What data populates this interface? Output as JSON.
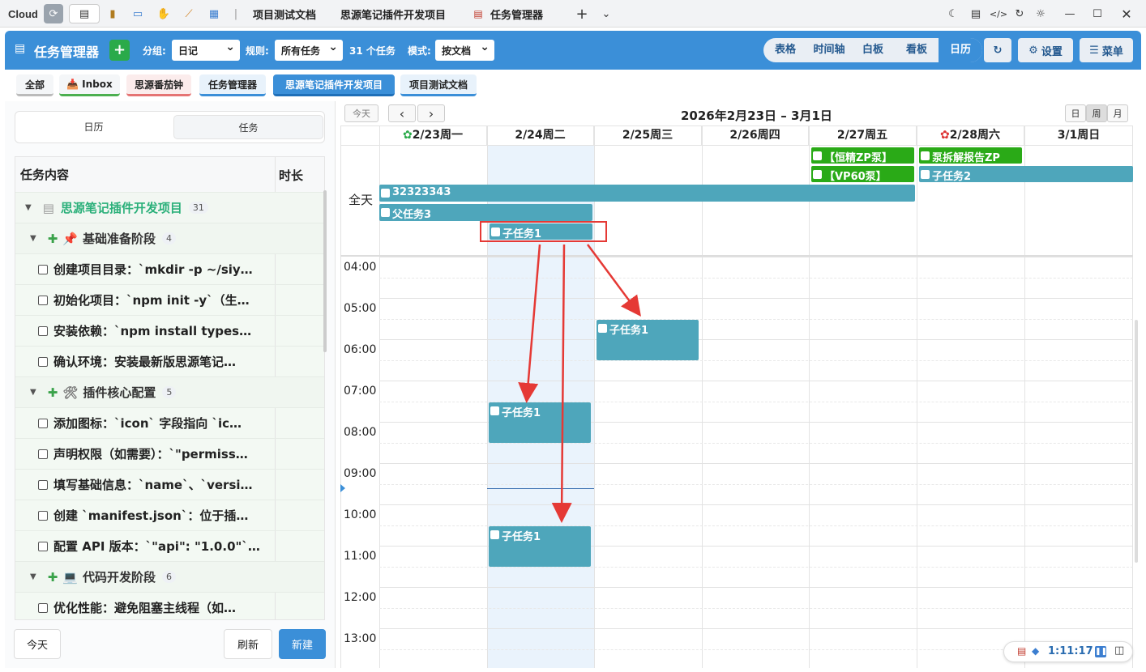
{
  "titlebar": {
    "app_name": "Cloud",
    "tabs": [
      "项目测试文档",
      "思源笔记插件开发项目",
      "任务管理器"
    ]
  },
  "toolbar": {
    "title": "任务管理器",
    "add_label": "+",
    "group_label": "分组:",
    "group_value": "日记",
    "rule_label": "规则:",
    "rule_value": "所有任务",
    "task_count": "31 个任务",
    "mode_label": "模式:",
    "mode_value": "按文档",
    "views": [
      "表格",
      "时间轴",
      "白板",
      "看板",
      "日历"
    ],
    "active_view": "日历",
    "settings_label": "设置",
    "menu_label": "菜单"
  },
  "project_tabs": [
    {
      "label": "全部",
      "color": "#cccccc"
    },
    {
      "label": "Inbox",
      "color": "#4caf50"
    },
    {
      "label": "思源番茄钟",
      "color": "#e57373"
    },
    {
      "label": "任务管理器",
      "color": "#3b8fd8"
    },
    {
      "label": "思源笔记插件开发项目",
      "color": "#3b8fd8"
    },
    {
      "label": "项目测试文档",
      "color": "#3b8fd8"
    }
  ],
  "active_project_tab": "思源笔记插件开发项目",
  "sidebar": {
    "segments": [
      "日历",
      "任务"
    ],
    "col_task": "任务内容",
    "col_duration": "时长",
    "project": {
      "name": "思源笔记插件开发项目",
      "count": "31"
    },
    "groups": [
      {
        "icon": "📌",
        "name": "基础准备阶段",
        "count": "4",
        "items": [
          "创建项目目录：`mkdir -p ~/siy…",
          "初始化项目：`npm init -y`（生…",
          "安装依赖：`npm install types…",
          "确认环境：安装最新版思源笔记…"
        ]
      },
      {
        "icon": "🛠",
        "name": "插件核心配置",
        "count": "5",
        "items": [
          "添加图标：`icon` 字段指向 `ic…",
          "声明权限（如需要）：`\"permiss…",
          "填写基础信息：`name`、`versi…",
          "创建 `manifest.json`：位于插…",
          "配置 API 版本：`\"api\": \"1.0.0\"`…"
        ]
      },
      {
        "icon": "💻",
        "name": "代码开发阶段",
        "count": "6",
        "items": [
          "优化性能：避免阻塞主线程（如…"
        ]
      }
    ],
    "today": "今天",
    "refresh": "刷新",
    "new": "新建"
  },
  "calendar": {
    "today_btn": "今天",
    "prev": "‹",
    "next": "›",
    "range_title": "2026年2月23日 – 3月1日",
    "view_buttons": [
      "日",
      "周",
      "月"
    ],
    "active_view_button": "周",
    "allday_label": "全天",
    "days": [
      "2/23周一",
      "2/24周二",
      "2/25周三",
      "2/26周四",
      "2/27周五",
      "2/28周六",
      "3/1周日"
    ],
    "hours": [
      "04:00",
      "05:00",
      "06:00",
      "07:00",
      "08:00",
      "09:00",
      "10:00",
      "11:00",
      "12:00",
      "13:00"
    ],
    "allday_events": [
      {
        "title": "【恒精ZP泵】",
        "color": "#2aaa17"
      },
      {
        "title": "【VP60泵】",
        "color": "#2aaa17"
      },
      {
        "title": "泵拆解报告ZP",
        "color": "#2aaa17"
      },
      {
        "title": "子任务2",
        "color": "#4ea6bb"
      },
      {
        "title": "32323343",
        "color": "#4ea6bb"
      },
      {
        "title": "父任务3",
        "color": "#4ea6bb"
      },
      {
        "title": "子任务1",
        "color": "#4ea6bb"
      }
    ],
    "timed_events": [
      {
        "title": "子任务1",
        "day": "2/25周三",
        "start": "05:30",
        "end": "06:30"
      },
      {
        "title": "子任务1",
        "day": "2/24周二",
        "start": "07:15",
        "end": "08:15"
      },
      {
        "title": "子任务1",
        "day": "2/24周二",
        "start": "10:15",
        "end": "11:15"
      }
    ],
    "now_time": "09:20"
  },
  "status": {
    "timer": "1:11:17"
  }
}
